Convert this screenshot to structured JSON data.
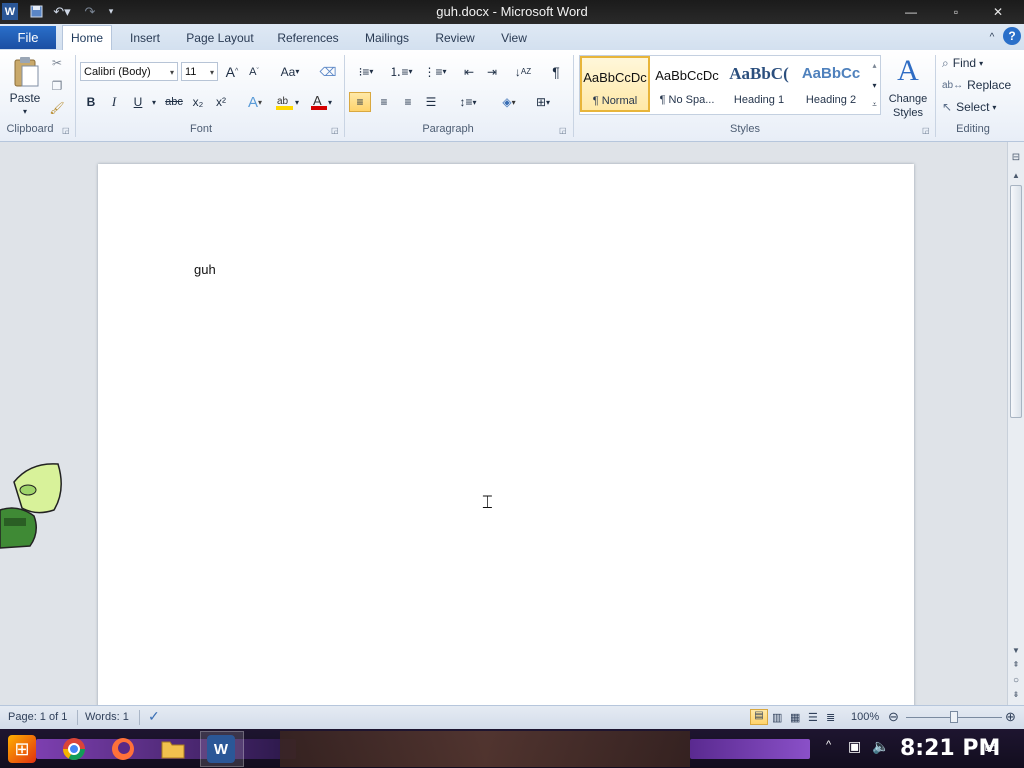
{
  "window": {
    "title": "guh.docx - Microsoft Word",
    "app_icon_letter": "W"
  },
  "tabs": [
    {
      "label": "File"
    },
    {
      "label": "Home"
    },
    {
      "label": "Insert"
    },
    {
      "label": "Page Layout"
    },
    {
      "label": "References"
    },
    {
      "label": "Mailings"
    },
    {
      "label": "Review"
    },
    {
      "label": "View"
    }
  ],
  "ribbon": {
    "clipboard": {
      "group_label": "Clipboard",
      "paste_label": "Paste"
    },
    "font": {
      "group_label": "Font",
      "font_name": "Calibri (Body)",
      "font_size": "11",
      "bold": "B",
      "italic": "I",
      "underline": "U",
      "strike": "abc",
      "subscript": "x₂",
      "superscript": "x²",
      "grow": "A",
      "shrink": "A",
      "change_case": "Aa"
    },
    "paragraph": {
      "group_label": "Paragraph"
    },
    "styles": {
      "group_label": "Styles",
      "items": [
        {
          "sample": "AaBbCcDc",
          "name": "¶ Normal"
        },
        {
          "sample": "AaBbCcDc",
          "name": "¶ No Spa..."
        },
        {
          "sample": "AaBbC(",
          "name": "Heading 1"
        },
        {
          "sample": "AaBbCc",
          "name": "Heading 2"
        }
      ],
      "change_styles_label": "Change Styles"
    },
    "editing": {
      "group_label": "Editing",
      "find": "Find",
      "replace": "Replace",
      "select": "Select"
    }
  },
  "document": {
    "text": "guh"
  },
  "statusbar": {
    "page": "Page: 1 of 1",
    "words": "Words: 1",
    "zoom": "100%"
  },
  "taskbar": {
    "clock": "8:21 PM"
  },
  "colors": {
    "file_tab": "#1b4fa3",
    "highlight": "#ffd800",
    "font_color": "#d40000",
    "selected_style_border": "#e8b53a"
  }
}
